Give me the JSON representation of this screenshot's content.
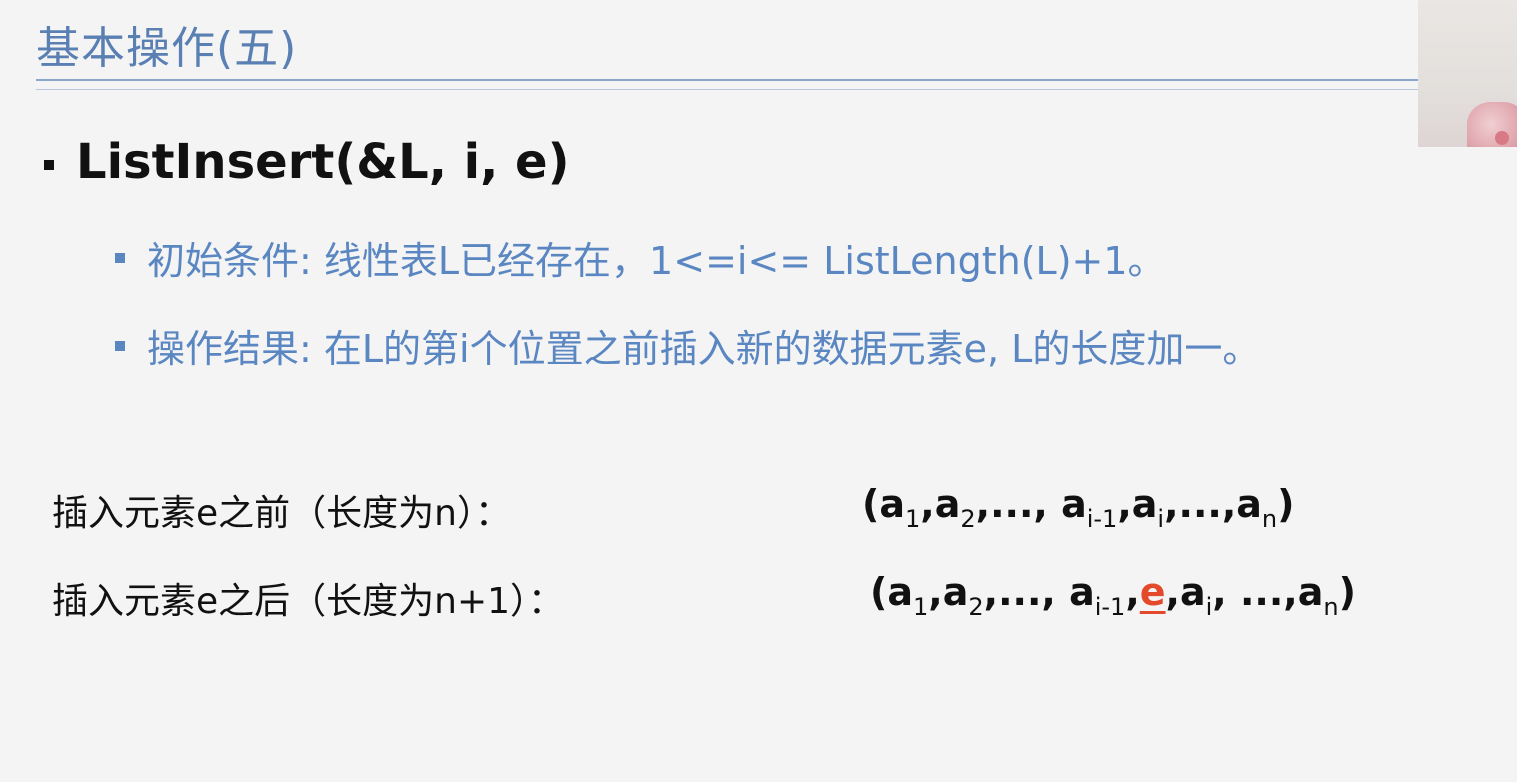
{
  "slide": {
    "title": "基本操作(五)",
    "heading": "ListInsert(&L, i, e)",
    "bullets": [
      "初始条件: 线性表L已经存在，1<=i<= ListLength(L)+1。",
      "操作结果: 在L的第i个位置之前插入新的数据元素e, L的长度加一。"
    ],
    "before": {
      "label": "插入元素e之前（长度为n）：",
      "seq_open": "(a",
      "sub1": "1",
      "t1": ",a",
      "sub2": "2",
      "t2": ",..., a",
      "sub3": "i-1",
      "t3": ",a",
      "sub4": "i",
      "t4": ",...,a",
      "sub5": "n",
      "seq_close": ")"
    },
    "after": {
      "label": "插入元素e之后（长度为n+1）：",
      "seq_open": "(a",
      "sub1": "1",
      "t1": ",a",
      "sub2": "2",
      "t2": ",..., a",
      "sub3": "i-1",
      "t3a": ",",
      "highlight": "e",
      "t3b": ",a",
      "sub4": "i",
      "t4": ", ...,a",
      "sub5": "n",
      "seq_close": ")"
    }
  },
  "colors": {
    "title": "#5a7fb3",
    "bullet_text": "#5a86c2",
    "highlight": "#e34a2b"
  }
}
